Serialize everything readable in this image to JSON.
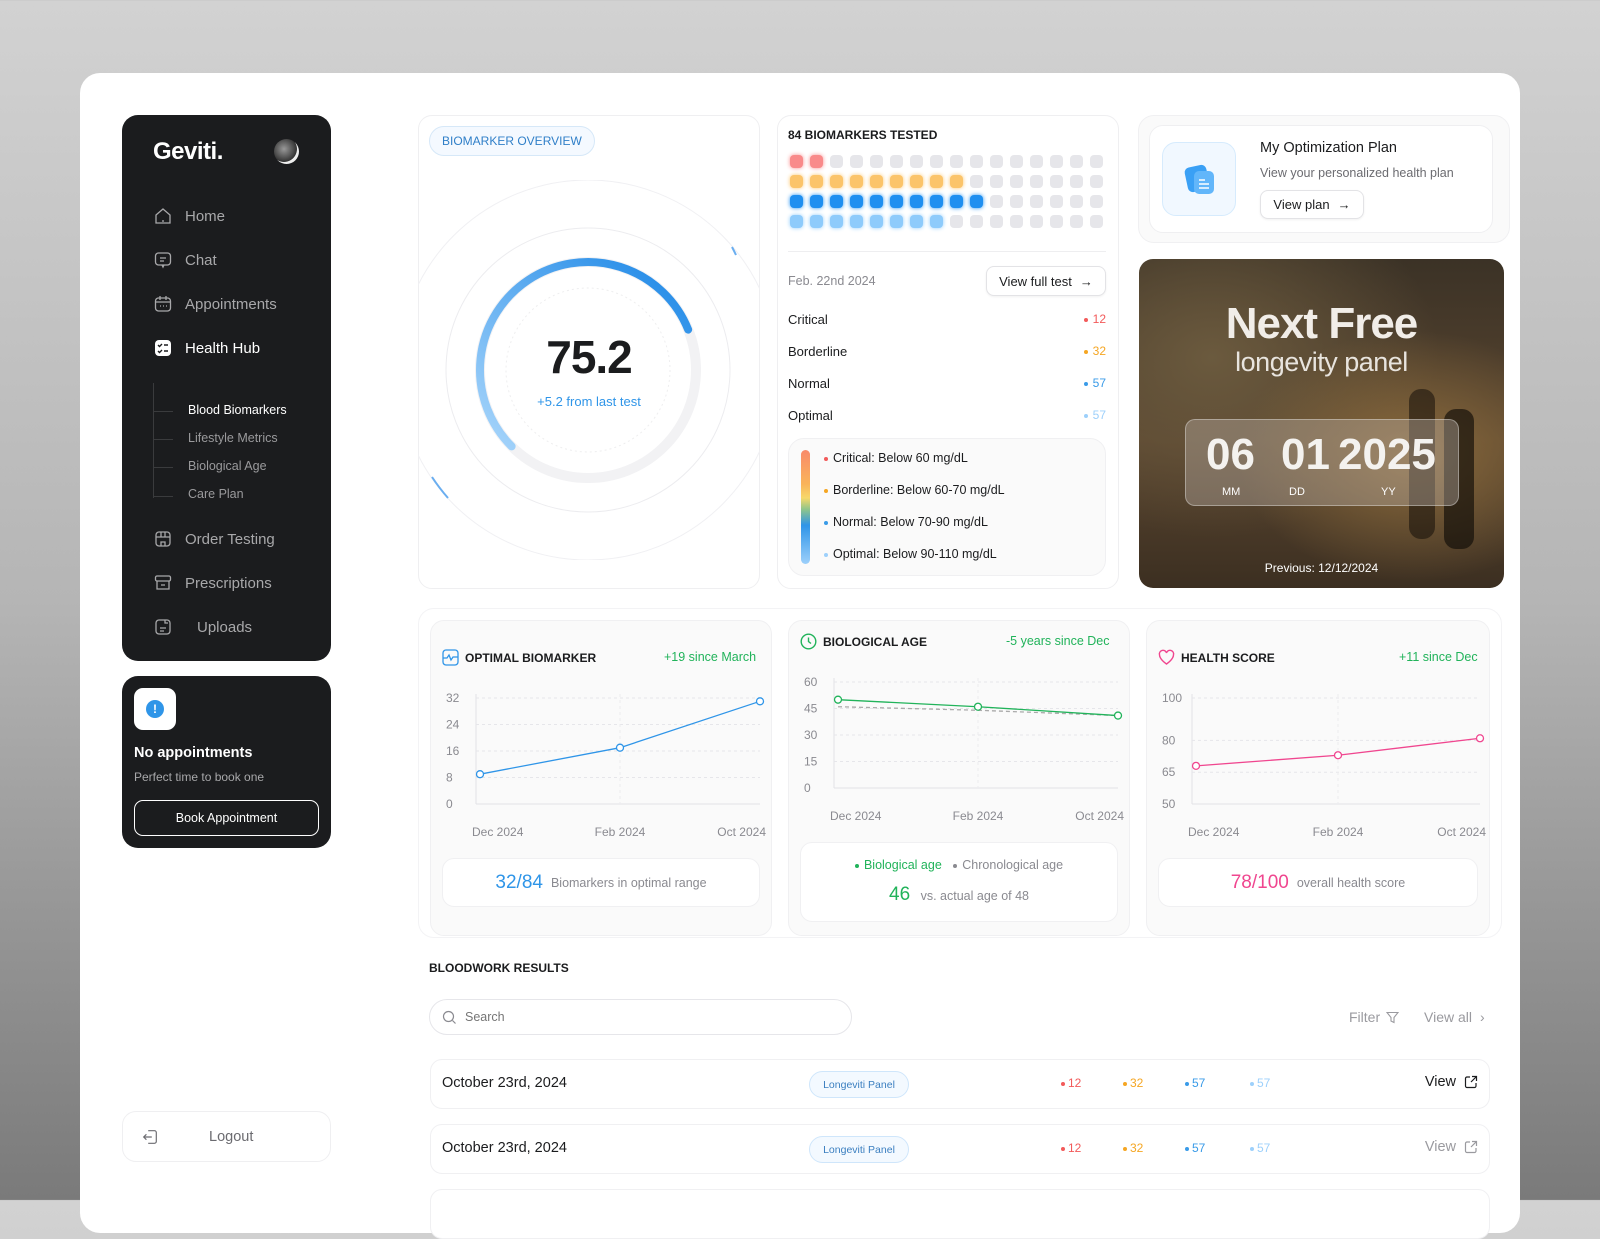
{
  "sidebar": {
    "logo": "Geviti.",
    "nav": [
      {
        "label": "Home",
        "icon": "home-icon"
      },
      {
        "label": "Chat",
        "icon": "chat-icon"
      },
      {
        "label": "Appointments",
        "icon": "calendar-icon"
      },
      {
        "label": "Health Hub",
        "icon": "health-hub-icon",
        "active": true
      }
    ],
    "sub": [
      "Blood Biomarkers",
      "Lifestyle Metrics",
      "Biological Age",
      "Care Plan"
    ],
    "nav2": [
      {
        "label": "Order Testing",
        "icon": "store-icon"
      },
      {
        "label": "Prescriptions",
        "icon": "archive-icon"
      },
      {
        "label": "Uploads",
        "icon": "file-icon"
      }
    ],
    "logout": "Logout"
  },
  "appointments": {
    "title": "No appointments",
    "subtitle": "Perfect time to book one",
    "button": "Book Appointment"
  },
  "overview": {
    "badge": "BIOMARKER OVERVIEW",
    "score": "75.2",
    "score_value": 75.2,
    "delta": "+5.2 from last test"
  },
  "tested": {
    "title": "84 BIOMARKERS TESTED",
    "grid_counts": {
      "critical": 2,
      "borderline": 9,
      "normal": 10,
      "optimal": 8
    },
    "date": "Feb. 22nd 2024",
    "view_button": "View full test",
    "rows": [
      {
        "label": "Critical",
        "value": "12",
        "color": "#f25a5a"
      },
      {
        "label": "Borderline",
        "value": "32",
        "color": "#f5a623"
      },
      {
        "label": "Normal",
        "value": "57",
        "color": "#3a9be8"
      },
      {
        "label": "Optimal",
        "value": "57",
        "color": "#9dd0fb"
      }
    ],
    "legend": [
      "Critical: Below 60 mg/dL",
      "Borderline: Below 60-70 mg/dL",
      "Normal: Below 70-90 mg/dL",
      "Optimal: Below 90-110 mg/dL"
    ]
  },
  "plan": {
    "title": "My Optimization Plan",
    "subtitle": "View your personalized health plan",
    "button": "View plan"
  },
  "promo": {
    "title": "Next Free",
    "subtitle": "longevity panel",
    "mm": "06",
    "dd": "01",
    "yy": "2025",
    "mm_label": "MM",
    "dd_label": "DD",
    "yy_label": "YY",
    "previous": "Previous: 12/12/2024"
  },
  "cards": {
    "optimal": {
      "title": "OPTIMAL BIOMARKER",
      "delta": "+19 since March",
      "big": "32/84",
      "small": "Biomarkers in optimal range"
    },
    "bio": {
      "title": "BIOLOGICAL AGE",
      "delta": "-5 years since Dec",
      "legend_a": "Biological age",
      "legend_b": "Chronological age",
      "big": "46",
      "small": "vs. actual age of 48"
    },
    "health": {
      "title": "HEALTH SCORE",
      "delta": "+11 since Dec",
      "big": "78/100",
      "small": "overall health score"
    }
  },
  "chart_data": [
    {
      "type": "line",
      "title": "OPTIMAL BIOMARKER",
      "categories": [
        "Dec 2024",
        "Feb 2024",
        "Oct 2024"
      ],
      "yticks": [
        0,
        8,
        16,
        24,
        32
      ],
      "ylim": [
        0,
        32
      ],
      "series": [
        {
          "name": "Optimal biomarkers",
          "values": [
            9,
            17,
            31
          ],
          "color": "#2f95e8"
        }
      ]
    },
    {
      "type": "line",
      "title": "BIOLOGICAL AGE",
      "categories": [
        "Dec 2024",
        "Feb 2024",
        "Oct 2024"
      ],
      "yticks": [
        0,
        15,
        30,
        45,
        60
      ],
      "ylim": [
        0,
        60
      ],
      "series": [
        {
          "name": "Biological age",
          "values": [
            50,
            46,
            41
          ],
          "color": "#21b35a"
        },
        {
          "name": "Chronological age",
          "values": [
            46,
            44,
            41
          ],
          "color": "#aaaaaa",
          "dashed": true
        }
      ]
    },
    {
      "type": "line",
      "title": "HEALTH SCORE",
      "categories": [
        "Dec 2024",
        "Feb 2024",
        "Oct 2024"
      ],
      "yticks": [
        50,
        65,
        80,
        100
      ],
      "ylim": [
        50,
        100
      ],
      "series": [
        {
          "name": "Health score",
          "values": [
            68,
            73,
            81
          ],
          "color": "#f0468f"
        }
      ]
    }
  ],
  "bloodwork": {
    "title": "BLOODWORK RESULTS",
    "search_placeholder": "Search",
    "filter": "Filter",
    "view_all": "View all",
    "rows": [
      {
        "date": "October 23rd, 2024",
        "panel": "Longeviti Panel",
        "critical": "12",
        "borderline": "32",
        "normal": "57",
        "optimal": "57",
        "view": "View"
      },
      {
        "date": "October 23rd, 2024",
        "panel": "Longeviti Panel",
        "critical": "12",
        "borderline": "32",
        "normal": "57",
        "optimal": "57",
        "view": "View"
      }
    ]
  }
}
